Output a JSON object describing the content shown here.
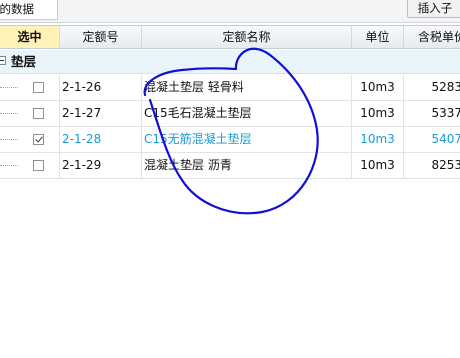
{
  "toolbar": {
    "tab_label": "我的数据",
    "insert_label": "插入子"
  },
  "columns": {
    "select": "选中",
    "code": "定额号",
    "name": "定额名称",
    "unit": "单位",
    "price": "含税单价"
  },
  "group": {
    "label": "垫层",
    "expanded": true
  },
  "rows": [
    {
      "code": "2-1-26",
      "name": "混凝土垫层 轻骨料",
      "unit": "10m3",
      "price": "5283",
      "checked": false,
      "highlight": false
    },
    {
      "code": "2-1-27",
      "name": "C15毛石混凝土垫层",
      "unit": "10m3",
      "price": "5337",
      "checked": false,
      "highlight": false
    },
    {
      "code": "2-1-28",
      "name": "C15无筋混凝土垫层",
      "unit": "10m3",
      "price": "5407",
      "checked": true,
      "highlight": true
    },
    {
      "code": "2-1-29",
      "name": "混凝土垫层 沥青",
      "unit": "10m3",
      "price": "8253",
      "checked": false,
      "highlight": false
    }
  ],
  "colors": {
    "highlight_text": "#1a9bd7",
    "annotation_ink": "#1010d8",
    "header_select_bg": "#fff2b8",
    "group_bg": "#e9f5fb"
  }
}
